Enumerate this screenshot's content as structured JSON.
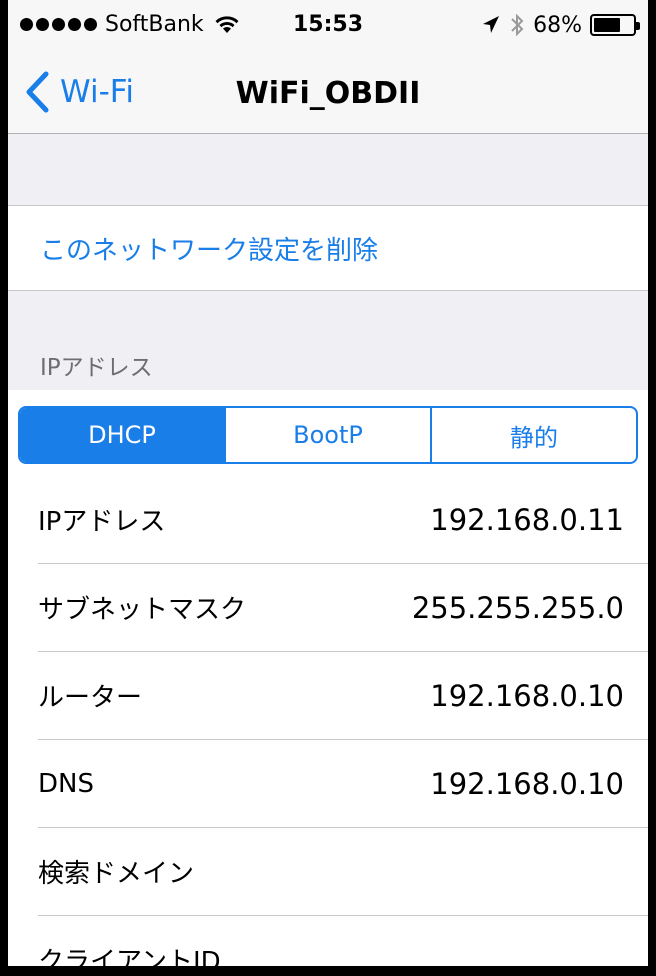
{
  "status_bar": {
    "carrier": "SoftBank",
    "time": "15:53",
    "battery": "68%",
    "battery_level": 0.68
  },
  "nav": {
    "back_label": "Wi-Fi",
    "title": "WiFi_OBDII"
  },
  "actions": {
    "forget_network": "このネットワーク設定を削除"
  },
  "ip_section": {
    "header": "IPアドレス",
    "modes": [
      "DHCP",
      "BootP",
      "静的"
    ],
    "selected_mode": "DHCP"
  },
  "rows": [
    {
      "label": "IPアドレス",
      "value": "192.168.0.11"
    },
    {
      "label": "サブネットマスク",
      "value": "255.255.255.0"
    },
    {
      "label": "ルーター",
      "value": "192.168.0.10"
    },
    {
      "label": "DNS",
      "value": "192.168.0.10"
    },
    {
      "label": "検索ドメイン",
      "value": ""
    },
    {
      "label": "クライアントID",
      "value": ""
    }
  ],
  "colors": {
    "accent": "#1a7ee9",
    "background": "#efeff4"
  }
}
